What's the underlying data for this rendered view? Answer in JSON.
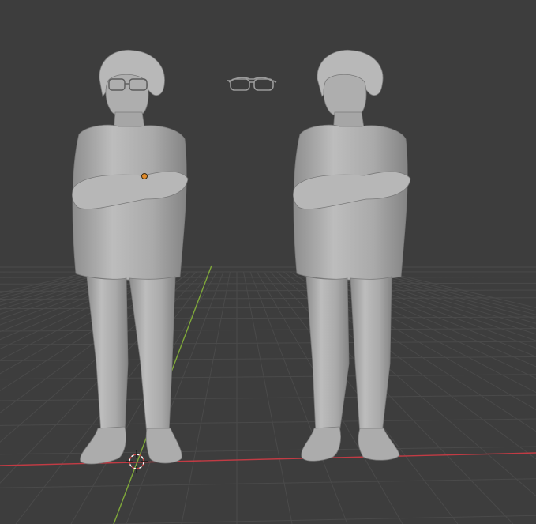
{
  "viewport": {
    "background": "#3d3d3d",
    "grid_color": "#4a4a4a",
    "x_axis_color": "#c23b44",
    "y_axis_color": "#7fa83a",
    "model_color": "#b4b4b4",
    "origin_color": "#e08a2a",
    "cursor_color": "#ffffff"
  },
  "scene": {
    "objects": [
      {
        "name": "figure-with-glasses",
        "has_glasses": true
      },
      {
        "name": "glasses"
      },
      {
        "name": "figure-without-glasses",
        "has_glasses": false
      }
    ]
  },
  "icons": {
    "cursor": "3d-cursor-icon",
    "origin": "object-origin-icon"
  }
}
